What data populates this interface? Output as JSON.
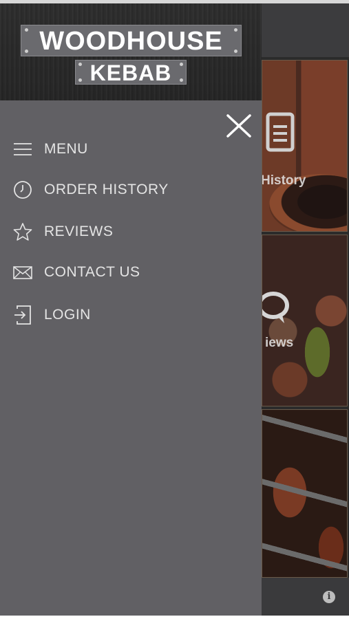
{
  "app": {
    "tiles": [
      {
        "label": "History"
      },
      {
        "label": "iews"
      }
    ]
  },
  "drawer": {
    "logo": {
      "line1": "WOODHOUSE",
      "line2": "KEBAB"
    },
    "menu_items": [
      {
        "label": "MENU",
        "icon": "hamburger-icon"
      },
      {
        "label": "ORDER HISTORY",
        "icon": "clock-icon"
      },
      {
        "label": "REVIEWS",
        "icon": "star-icon"
      },
      {
        "label": "CONTACT US",
        "icon": "envelope-icon"
      },
      {
        "label": "LOGIN",
        "icon": "login-icon"
      }
    ]
  },
  "colors": {
    "drawer_bg": "#616064",
    "menu_text": "#e4e4e4",
    "logo_plate": "#6a6a6e"
  }
}
